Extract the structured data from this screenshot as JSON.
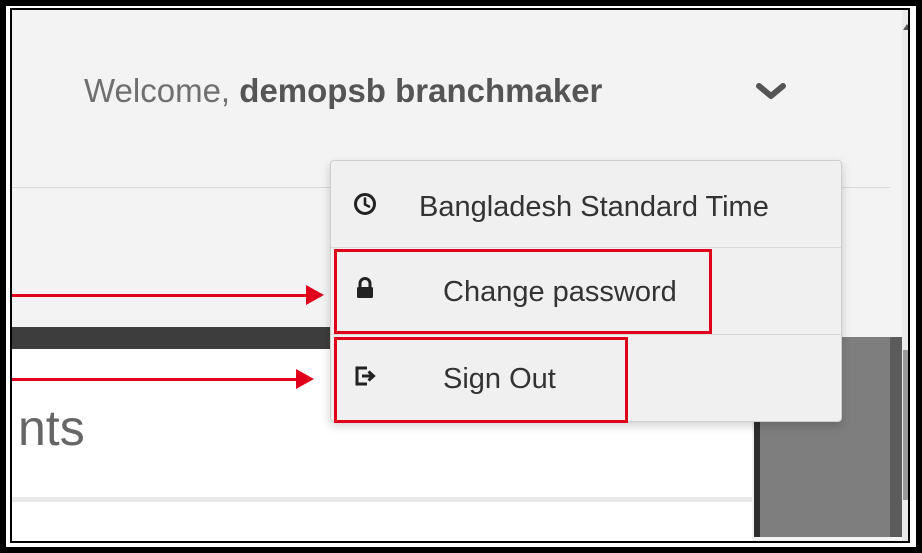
{
  "header": {
    "welcome_prefix": "Welcome, ",
    "username": "demopsb branchmaker"
  },
  "dropdown": {
    "items": [
      {
        "label": "Bangladesh Standard Time",
        "icon": "clock-icon"
      },
      {
        "label": "Change password",
        "icon": "lock-icon"
      },
      {
        "label": "Sign Out",
        "icon": "sign-out-icon"
      }
    ]
  },
  "page": {
    "heading_fragment": "nts"
  },
  "colors": {
    "highlight": "#e0001b",
    "menu_bg": "#f0f0f0",
    "page_bg": "#f3f3f3"
  }
}
